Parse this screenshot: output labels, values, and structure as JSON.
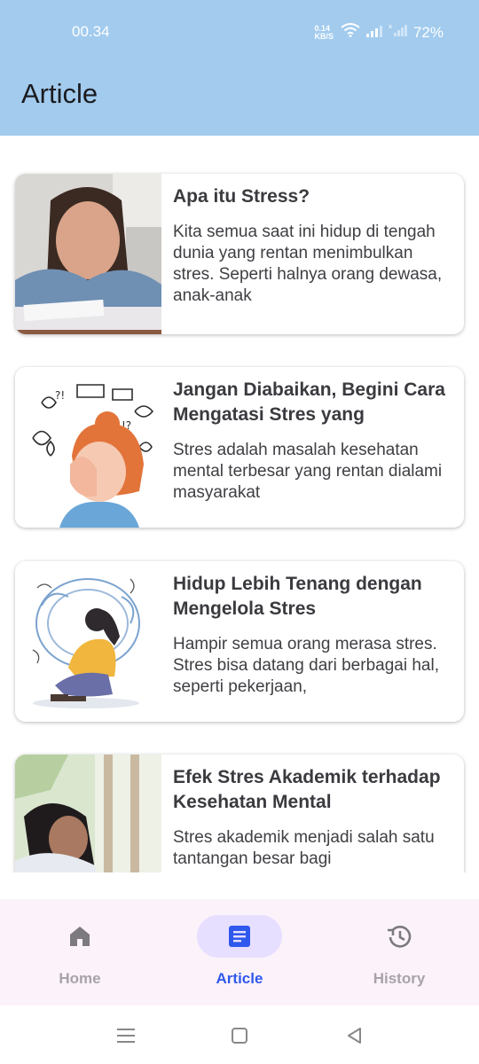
{
  "status_bar": {
    "time": "00.34",
    "net_speed_value": "0.14",
    "net_speed_unit": "KB/S",
    "battery": "72%"
  },
  "app_bar": {
    "title": "Article"
  },
  "articles": [
    {
      "title": "Apa itu Stress?",
      "excerpt": "Kita semua saat ini hidup di tengah dunia yang rentan menimbulkan stres. Seperti halnya orang dewasa, anak-anak",
      "image": "person-covering-face-photo"
    },
    {
      "title": "Jangan Diabaikan, Begini Cara Mengatasi Stres yang",
      "excerpt": "Stres adalah masalah kesehatan mental terbesar yang rentan dialami masyarakat",
      "image": "stressed-woman-illustration"
    },
    {
      "title": "Hidup Lebih Tenang dengan Mengelola Stres",
      "excerpt": "Hampir semua orang merasa stres. Stres bisa datang dari berbagai hal, seperti pekerjaan,",
      "image": "sitting-girl-illustration"
    },
    {
      "title": "Efek Stres Akademik terhadap Kesehatan Mental",
      "excerpt": "Stres akademik menjadi salah satu tantangan besar bagi",
      "image": "student-at-desk-photo"
    }
  ],
  "bottom_nav": {
    "items": [
      {
        "label": "Home",
        "icon": "home-icon",
        "active": false
      },
      {
        "label": "Article",
        "icon": "article-icon",
        "active": true
      },
      {
        "label": "History",
        "icon": "history-icon",
        "active": false
      }
    ]
  },
  "colors": {
    "app_bar": "#a2cbee",
    "active": "#2f58ed",
    "active_pill": "#e6dfff",
    "nav_background": "#fbf2fa"
  }
}
